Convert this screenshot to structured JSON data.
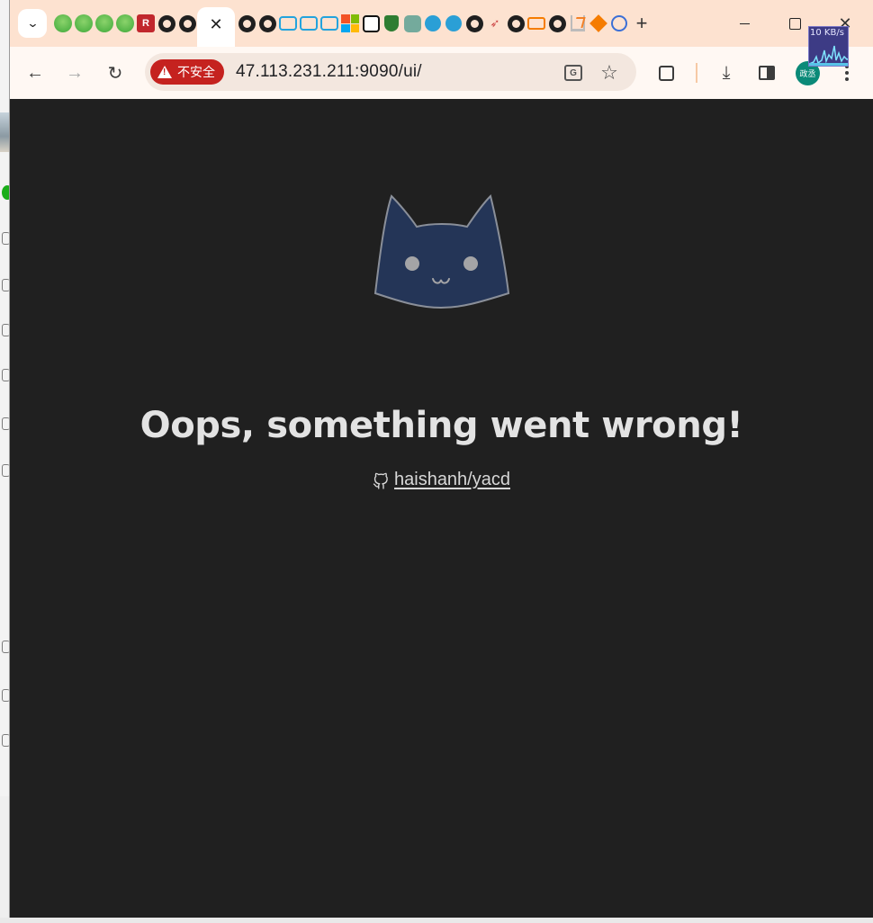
{
  "browser": {
    "tab_search_icon": "chevron-down-icon",
    "pinned_tabs_left": [
      "green-bubble",
      "green-bubble",
      "green-bubble",
      "green-bubble",
      "r-logo",
      "github",
      "github"
    ],
    "active_tab": {
      "close_icon": "close-icon",
      "close_symbol": "✕"
    },
    "pinned_tabs_right": [
      "github",
      "github",
      "bilibili",
      "bilibili",
      "bilibili",
      "microsoft",
      "terminal",
      "shield",
      "chatgpt",
      "bird",
      "bird",
      "github",
      "arrow",
      "github",
      "bracket",
      "github",
      "stackoverflow",
      "diamond",
      "history"
    ],
    "new_tab_symbol": "+",
    "window_controls": {
      "close_symbol": "✕"
    },
    "network_monitor": {
      "rate": "10 KB/s"
    }
  },
  "toolbar": {
    "back_symbol": "←",
    "forward_symbol": "→",
    "reload_symbol": "↻",
    "security_label": "不安全",
    "url": "47.113.231.211:9090/ui/",
    "star_symbol": "☆",
    "translate_glyph": "G",
    "download_symbol": "⤓",
    "avatar_label": "政丞"
  },
  "page": {
    "error_title": "Oops, something went wrong!",
    "repo_link": "haishanh/yacd",
    "colors": {
      "background": "#202020",
      "cat_face": "#243557",
      "title": "#e3e3e3"
    }
  }
}
